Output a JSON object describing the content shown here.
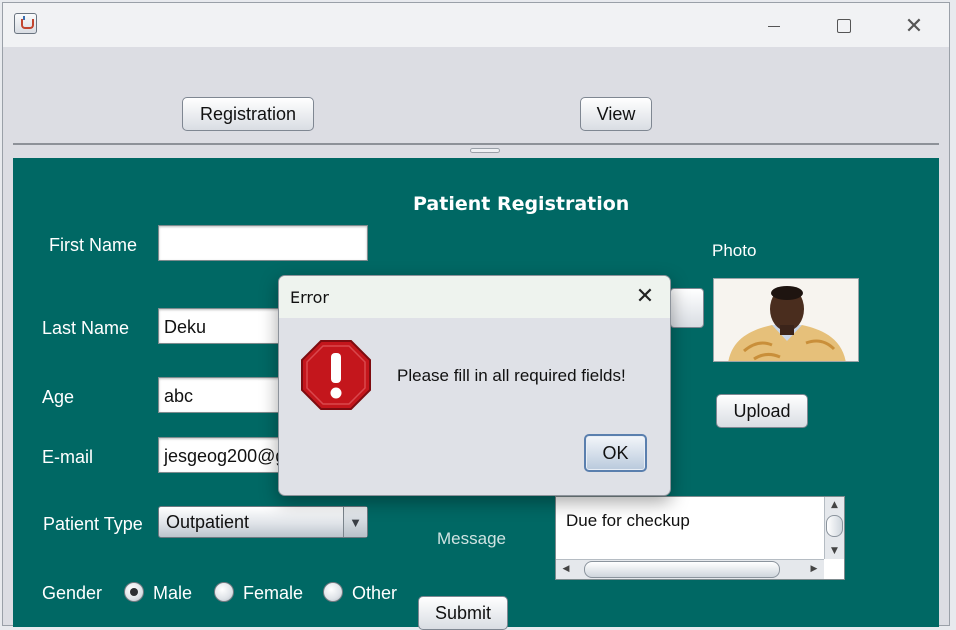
{
  "window": {
    "title": "",
    "icons": {
      "app": "java-cup-icon",
      "minimize": "minimize-icon",
      "maximize": "maximize-icon",
      "close": "close-icon"
    }
  },
  "toolbar": {
    "registration_label": "Registration",
    "view_label": "View"
  },
  "form": {
    "heading": "Patient Registration",
    "first_name_label": "First Name",
    "first_name_value": "",
    "last_name_label": "Last Name",
    "last_name_value": "Deku",
    "age_label": "Age",
    "age_value": "abc",
    "email_label": "E-mail",
    "email_value": "jesgeog200@g",
    "patient_type_label": "Patient Type",
    "patient_type_value": "Outpatient",
    "gender_label": "Gender",
    "gender_options": [
      "Male",
      "Female",
      "Other"
    ],
    "gender_selected": "Male",
    "photo_label": "Photo",
    "upload_label": "Upload",
    "message_label": "Message",
    "message_value": "Due for checkup",
    "submit_label": "Submit"
  },
  "dialog": {
    "title": "Error",
    "message": "Please fill in all required fields!",
    "ok_label": "OK",
    "icon": "error-icon"
  },
  "colors": {
    "panel_bg": "#006864",
    "window_bg": "#dcdde3",
    "error_red": "#c4161c"
  }
}
